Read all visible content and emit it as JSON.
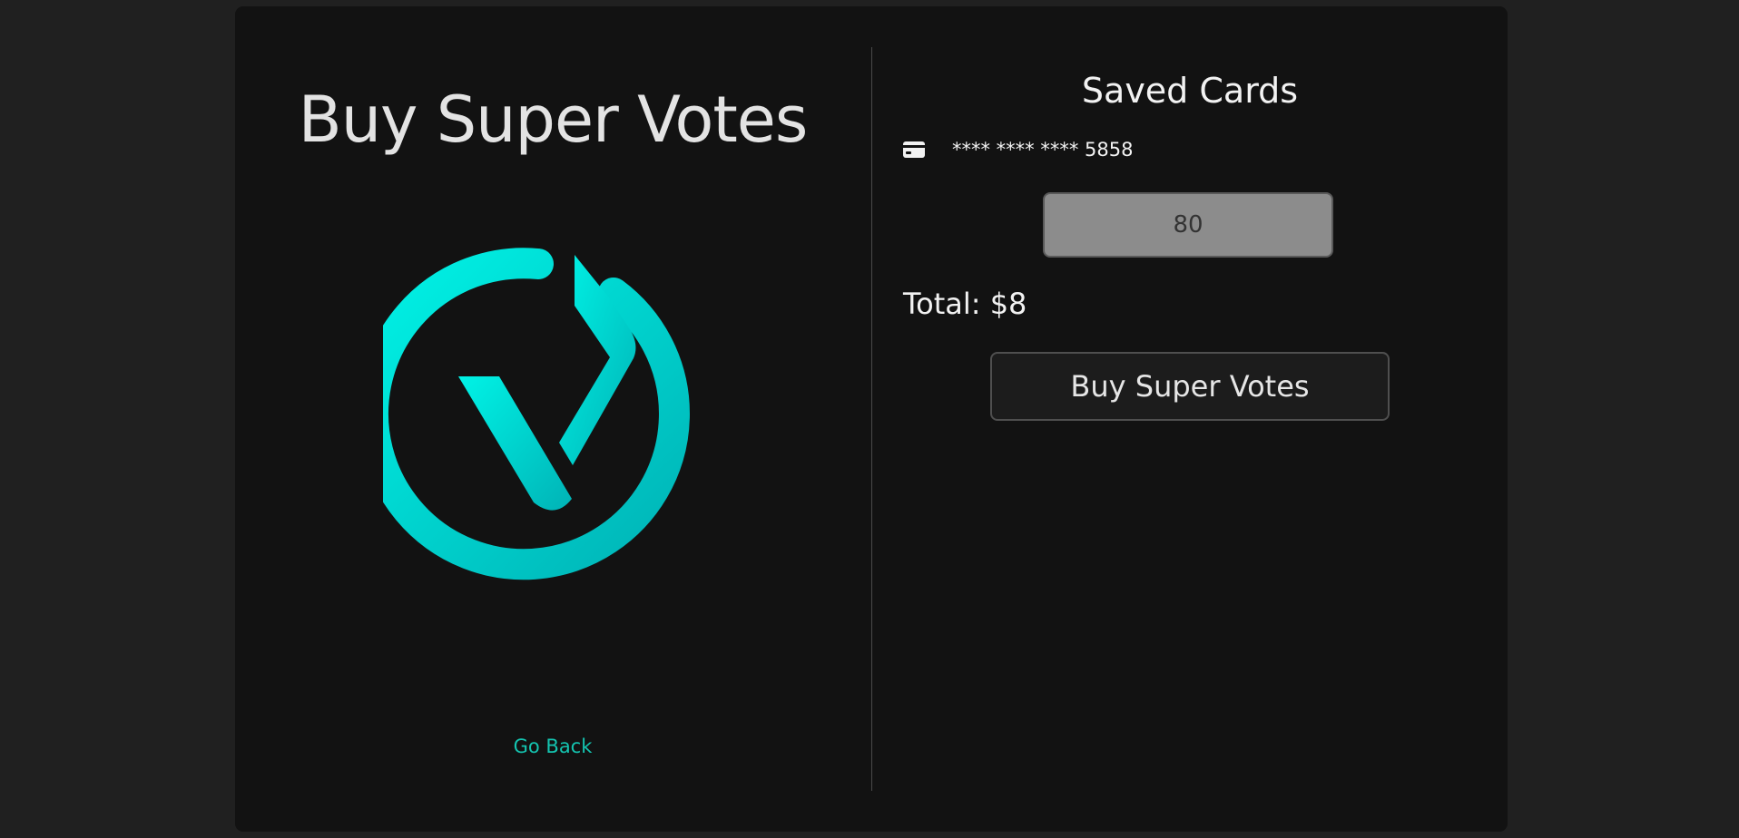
{
  "left": {
    "title": "Buy Super Votes",
    "logo_icon": "super-votes-logo-icon",
    "go_back_label": "Go Back"
  },
  "right": {
    "title": "Saved Cards",
    "saved_cards": [
      {
        "icon": "credit-card-icon",
        "number": "**** **** **** 5858"
      }
    ],
    "quantity_value": "80",
    "total_label": "Total: $8",
    "buy_button_label": "Buy Super Votes"
  },
  "colors": {
    "page_background": "#202020",
    "panel_background": "#121212",
    "accent": "#14c4b0",
    "logo_gradient_start": "#00f0e4",
    "logo_gradient_end": "#00b5b8"
  }
}
